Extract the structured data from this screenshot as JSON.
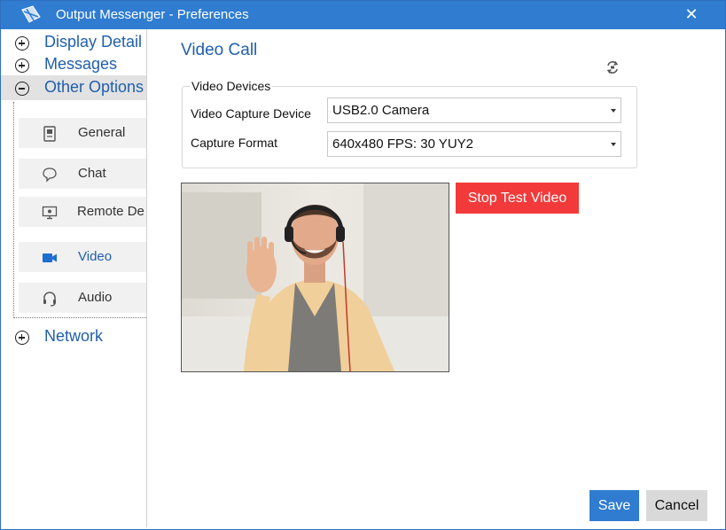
{
  "window": {
    "title": "Output Messenger - Preferences",
    "close_glyph": "✕"
  },
  "sidebar": {
    "categories": [
      {
        "label": "Display Detail",
        "state": "collapsed"
      },
      {
        "label": "Messages",
        "state": "collapsed"
      },
      {
        "label": "Other Options",
        "state": "expanded"
      },
      {
        "label": "Network",
        "state": "collapsed"
      }
    ],
    "sub_items": [
      {
        "label": "General",
        "icon": "general-icon"
      },
      {
        "label": "Chat",
        "icon": "chat-bubble-icon"
      },
      {
        "label": "Remote De",
        "icon": "remote-desktop-icon"
      },
      {
        "label": "Video",
        "icon": "video-camera-icon",
        "selected": true
      },
      {
        "label": "Audio",
        "icon": "headset-icon"
      }
    ]
  },
  "main": {
    "title": "Video Call",
    "group_title": "Video Devices",
    "fields": [
      {
        "label": "Video Capture Device",
        "value": "USB2.0 Camera"
      },
      {
        "label": "Capture Format",
        "value": "640x480 FPS: 30 YUY2"
      }
    ],
    "stop_button": "Stop Test Video",
    "save_button": "Save",
    "cancel_button": "Cancel"
  },
  "colors": {
    "titlebar": "#2f7cd0",
    "accent": "#1f5fad",
    "stop_button": "#f23a3a",
    "save_button": "#2f7cd0"
  }
}
